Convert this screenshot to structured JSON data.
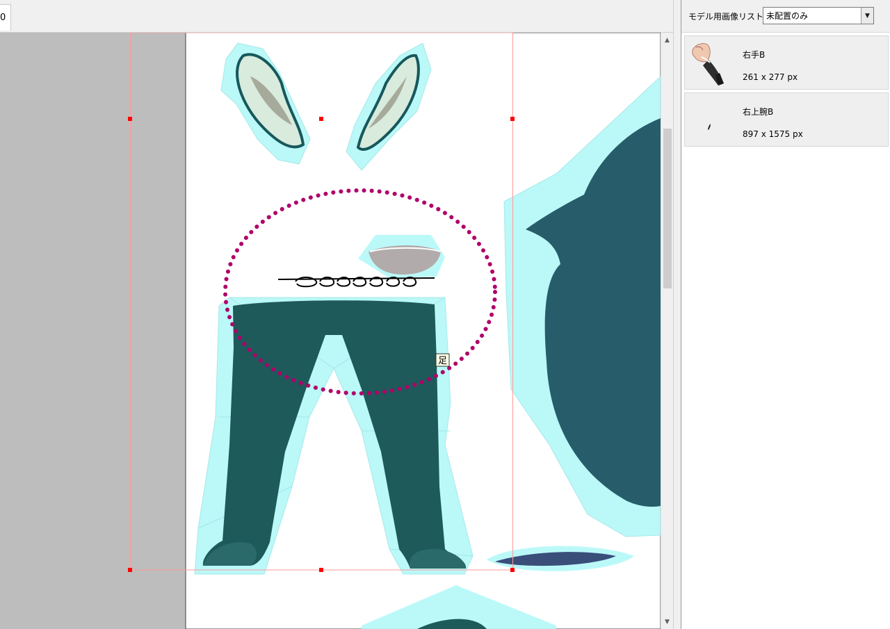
{
  "editor": {
    "tab_label": "0",
    "canvas": {
      "selected_part_label": "足"
    }
  },
  "right_panel": {
    "list_label": "モデル用画像リスト",
    "filter": {
      "value": "未配置のみ"
    },
    "items": [
      {
        "name": "右手B",
        "size": "261 x 277 px",
        "thumb_icon": "arm-hand-thumbnail"
      },
      {
        "name": "右上腕B",
        "size": "897 x 1575 px",
        "thumb_icon": "thin-stroke-thumbnail"
      }
    ]
  },
  "colors": {
    "mesh_fill": "#b4f8f8",
    "part_dark": "#1e5a5a",
    "selection_outline": "#ff9999",
    "handle": "#ff0000",
    "dotted_ring": "#b0006a"
  }
}
